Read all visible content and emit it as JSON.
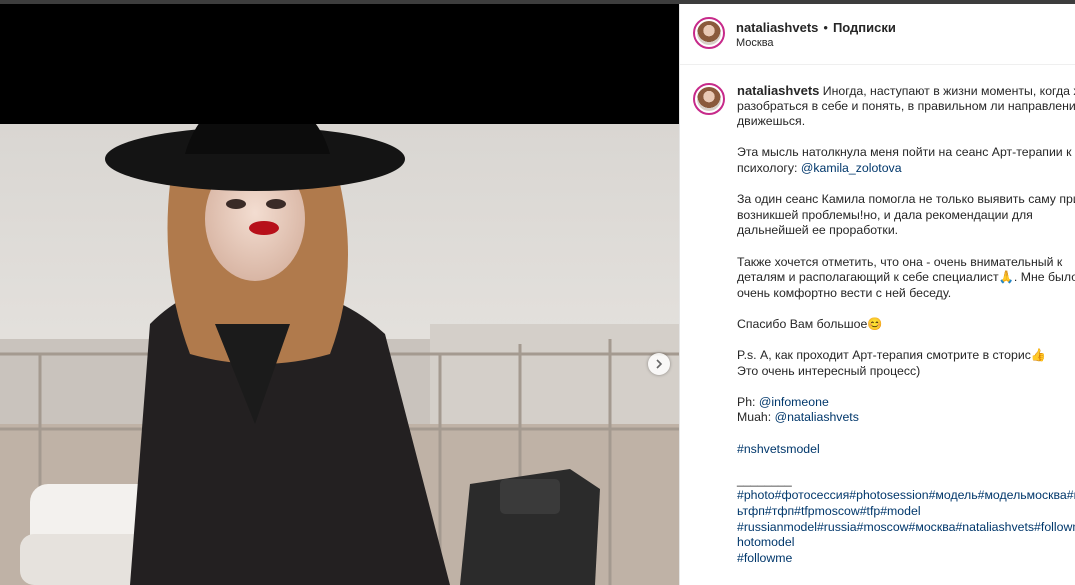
{
  "post": {
    "username": "nataliashvets",
    "separator": "•",
    "follow_label": "Подписки",
    "location": "Москва"
  },
  "caption": {
    "username": "nataliashvets",
    "line1": " Иногда, наступают в жизни моменты, когда хочется",
    "line2": "разобраться в себе и понять, в правильном ли направлении ты",
    "line3": "движешься.",
    "p2_line1": "Эта мысль натолкнула меня пойти на сеанс Арт-терапии к",
    "p2_line2_prefix": "психологу: ",
    "mention_kamila": "@kamila_zolotova",
    "p3_line1": "За один сеанс Камила помогла не только выявить саму причину",
    "p3_line2": "возникшей проблемы!но, и дала рекомендации для",
    "p3_line3": "дальнейшей ее проработки.",
    "p4_line1": "Также хочется отметить, что она - очень внимательный к",
    "p4_line2": "деталям и располагающий к себе специалист🙏. Мне было",
    "p4_line3": "очень комфортно вести с ней беседу.",
    "p5_line1": "Спасибо Вам большое😊",
    "p6_line1": "P.s. А, как проходит Арт-терапия смотрите в сторис👍",
    "p6_line2": "Это очень интересный процесс)",
    "ph_prefix": "Ph: ",
    "mention_ph": "@infomeone",
    "muah_prefix": "Muah: ",
    "mention_muah": "@nataliashvets",
    "tag_model": "#nshvetsmodel",
    "divider": "________",
    "tags_line1": "#photo#фотосессия#photosession#модель#модельмосква#мо",
    "tags_line2": "ьтфп#тфп#tfpmoscow#tfp#model",
    "tags_line3": "#russianmodel#russia#moscow#москва#nataliashvets#followm",
    "tags_line4": "hotomodel",
    "tags_line5": "#followme"
  },
  "icons": {
    "next": "chevron-right-icon",
    "avatar": "profile-avatar"
  },
  "colors": {
    "link": "#00376b",
    "text": "#262626",
    "avatar_ring": "#c72a8a"
  }
}
